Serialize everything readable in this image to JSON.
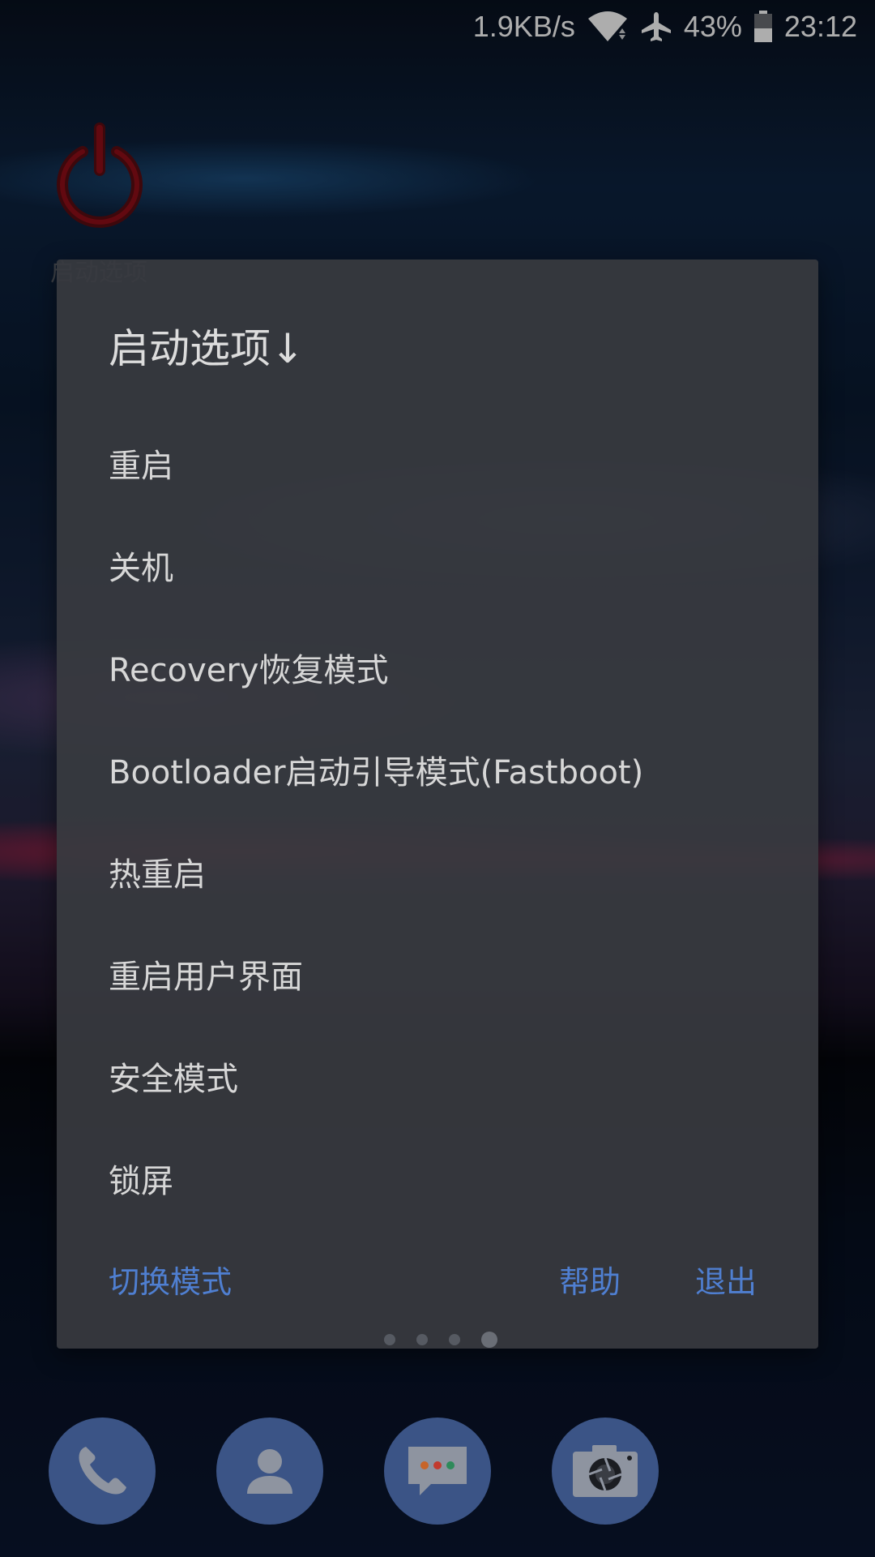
{
  "status_bar": {
    "speed": "1.9KB/s",
    "battery_percent": "43%",
    "time": "23:12",
    "icons": [
      "wifi-icon",
      "airplane-mode-icon",
      "battery-icon"
    ]
  },
  "desktop": {
    "widget_label": "启动选项",
    "widget_icon": "power-icon",
    "widget_icon_color": "#c0101e"
  },
  "dialog": {
    "title": "启动选项↓",
    "items": [
      {
        "label": "重启"
      },
      {
        "label": "关机"
      },
      {
        "label": "Recovery恢复模式"
      },
      {
        "label": "Bootloader启动引导模式(Fastboot)"
      },
      {
        "label": "热重启"
      },
      {
        "label": "重启用户界面"
      },
      {
        "label": "安全模式"
      },
      {
        "label": "锁屏"
      }
    ],
    "actions": {
      "switch_mode": "切换模式",
      "help": "帮助",
      "exit": "退出"
    },
    "accent_color": "#4f7fd1"
  },
  "page_indicator": {
    "count": 4,
    "active_index": 3
  },
  "dock": {
    "apps": [
      {
        "name": "phone",
        "icon": "phone-icon"
      },
      {
        "name": "contacts",
        "icon": "contacts-icon"
      },
      {
        "name": "messages",
        "icon": "messages-icon"
      },
      {
        "name": "camera",
        "icon": "camera-icon"
      }
    ]
  }
}
